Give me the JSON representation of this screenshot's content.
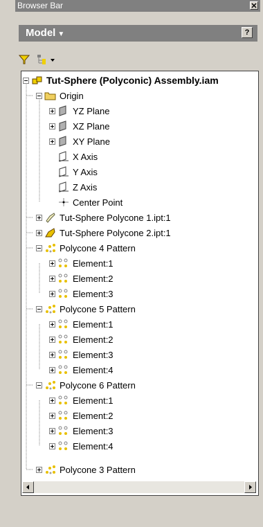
{
  "titlebar": {
    "title": "Browser Bar",
    "close_icon": "close-icon"
  },
  "panel": {
    "label": "Model",
    "dropdown_icon": "chevron-down-icon",
    "help_icon": "help-icon"
  },
  "toolbar": {
    "filter_icon": "filter-icon",
    "tree_options_icon": "tree-options-icon"
  },
  "tree": {
    "root": "Tut-Sphere (Polyconic) Assembly.iam",
    "origin": {
      "label": "Origin",
      "yz": "YZ Plane",
      "xz": "XZ Plane",
      "xy": "XY Plane",
      "x_axis": "X Axis",
      "y_axis": "Y Axis",
      "z_axis": "Z Axis",
      "center": "Center Point"
    },
    "part1": "Tut-Sphere Polycone 1.ipt:1",
    "part2": "Tut-Sphere Polycone 2.ipt:1",
    "pattern4": {
      "label": "Polycone 4 Pattern",
      "elements": [
        "Element:1",
        "Element:2",
        "Element:3"
      ]
    },
    "pattern5": {
      "label": "Polycone 5 Pattern",
      "elements": [
        "Element:1",
        "Element:2",
        "Element:3",
        "Element:4"
      ]
    },
    "pattern6": {
      "label": "Polycone 6 Pattern",
      "elements": [
        "Element:1",
        "Element:2",
        "Element:3",
        "Element:4"
      ]
    },
    "pattern3": {
      "label": "Polycone 3 Pattern"
    }
  },
  "colors": {
    "accent": "#808080",
    "selection_icon_yellow": "#e8c000",
    "folder": "#f0d060"
  }
}
